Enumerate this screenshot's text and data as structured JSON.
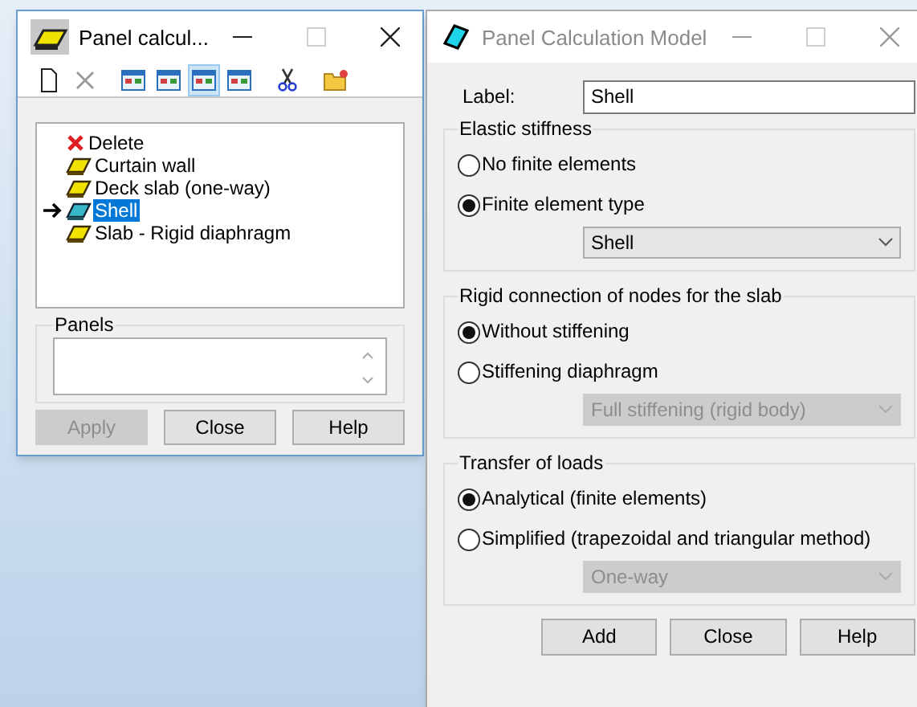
{
  "left_window": {
    "title": "Panel calcul...",
    "active": true,
    "kind": "slab",
    "toolbar": [
      {
        "kind": "new",
        "selected": false
      },
      {
        "kind": "delete",
        "selected": false
      },
      {
        "kind": "view",
        "selected": false
      },
      {
        "kind": "view",
        "selected": false
      },
      {
        "kind": "view",
        "selected": true
      },
      {
        "kind": "view",
        "selected": false
      },
      {
        "kind": "cut",
        "selected": false
      },
      {
        "kind": "folder",
        "selected": false
      }
    ],
    "tree": [
      {
        "label": "Delete",
        "kind": "delete",
        "selected": false,
        "current": false
      },
      {
        "label": "Curtain wall",
        "kind": "slab",
        "selected": false,
        "current": false
      },
      {
        "label": "Deck slab (one-way)",
        "kind": "slab",
        "selected": false,
        "current": false
      },
      {
        "label": "Shell",
        "kind": "shell",
        "selected": true,
        "current": true
      },
      {
        "label": "Slab - Rigid diaphragm",
        "kind": "slab",
        "selected": false,
        "current": false
      }
    ],
    "panels": {
      "title": "Panels"
    },
    "buttons": [
      {
        "label": "Apply",
        "disabled": true
      },
      {
        "label": "Close",
        "disabled": false
      },
      {
        "label": "Help",
        "disabled": false
      }
    ]
  },
  "right_window": {
    "title": "Panel Calculation Model",
    "active": false,
    "kind": "shell",
    "label_field": {
      "label": "Label:",
      "value": "Shell"
    },
    "groups": [
      {
        "title": "Elastic stiffness",
        "options": [
          {
            "label": "No finite elements",
            "selected": false
          },
          {
            "label": "Finite element type",
            "selected": true
          }
        ],
        "dropdown": {
          "value": "Shell",
          "disabled": false
        }
      },
      {
        "title": "Rigid connection of nodes for the slab",
        "options": [
          {
            "label": "Without stiffening",
            "selected": true
          },
          {
            "label": "Stiffening diaphragm",
            "selected": false
          }
        ],
        "dropdown": {
          "value": "Full stiffening (rigid body)",
          "disabled": true
        }
      },
      {
        "title": "Transfer of loads",
        "options": [
          {
            "label": "Analytical (finite elements)",
            "selected": true
          },
          {
            "label": "Simplified (trapezoidal and triangular method)",
            "selected": false
          }
        ],
        "dropdown": {
          "value": "One-way",
          "disabled": true
        }
      }
    ],
    "buttons": [
      {
        "label": "Add",
        "disabled": false
      },
      {
        "label": "Close",
        "disabled": false
      },
      {
        "label": "Help",
        "disabled": false
      }
    ]
  }
}
